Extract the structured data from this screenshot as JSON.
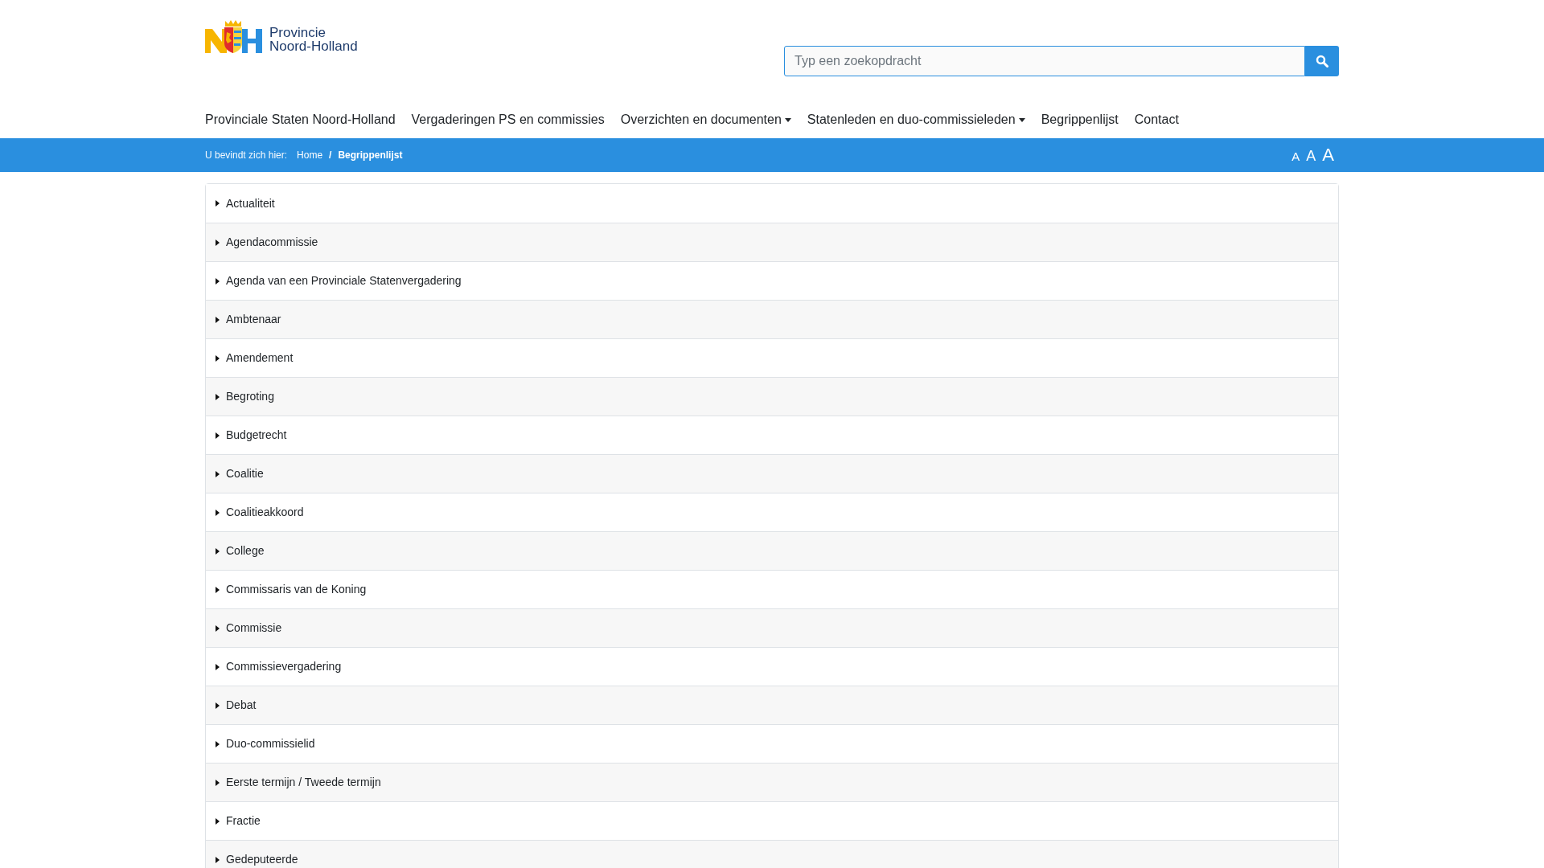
{
  "header": {
    "logo_text": [
      "Provincie",
      "Noord-Holland"
    ],
    "search": {
      "placeholder": "Typ een zoekopdracht"
    }
  },
  "nav": [
    {
      "label": "Provinciale Staten Noord-Holland",
      "kind": "link"
    },
    {
      "label": "Vergaderingen PS en commissies",
      "kind": "link"
    },
    {
      "label": "Overzichten en documenten",
      "kind": "dropdown"
    },
    {
      "label": "Statenleden en duo-commissieleden",
      "kind": "dropdown"
    },
    {
      "label": "Begrippenlijst",
      "kind": "link"
    },
    {
      "label": "Contact",
      "kind": "link"
    }
  ],
  "breadcrumb": {
    "label": "U bevindt zich hier:",
    "items": [
      {
        "label": "Home",
        "current": false
      },
      {
        "label": "Begrippenlijst",
        "current": true
      }
    ],
    "separator": "/"
  },
  "font_size_buttons": [
    "A",
    "A",
    "A"
  ],
  "terms": [
    {
      "label": "Actualiteit",
      "expanded": false
    },
    {
      "label": "Agendacommissie",
      "expanded": false
    },
    {
      "label": "Agenda van een Provinciale Statenvergadering",
      "expanded": false
    },
    {
      "label": "Ambtenaar",
      "expanded": false
    },
    {
      "label": "Amendement",
      "expanded": false
    },
    {
      "label": "Begroting",
      "expanded": false
    },
    {
      "label": "Budgetrecht",
      "expanded": false
    },
    {
      "label": "Coalitie",
      "expanded": false
    },
    {
      "label": "Coalitieakkoord",
      "expanded": false
    },
    {
      "label": "College",
      "expanded": false
    },
    {
      "label": "Commissaris van de Koning",
      "expanded": false
    },
    {
      "label": "Commissie",
      "expanded": false
    },
    {
      "label": "Commissievergadering",
      "expanded": false
    },
    {
      "label": "Debat",
      "expanded": false
    },
    {
      "label": "Duo-commissielid",
      "expanded": false
    },
    {
      "label": "Eerste termijn / Tweede termijn",
      "expanded": false
    },
    {
      "label": "Fractie",
      "expanded": false
    },
    {
      "label": "Gedeputeerde",
      "expanded": false
    }
  ]
}
